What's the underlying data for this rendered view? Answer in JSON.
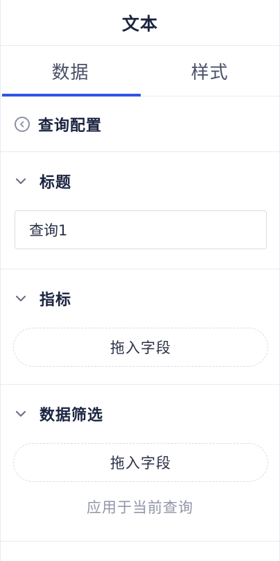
{
  "header": {
    "title": "文本"
  },
  "tabs": [
    {
      "label": "数据",
      "active": true
    },
    {
      "label": "样式",
      "active": false
    }
  ],
  "query_config": {
    "label": "查询配置",
    "icon": "back-circle-icon"
  },
  "sections": {
    "title": {
      "label": "标题",
      "input_value": "查询1",
      "icon": "chevron-down-icon"
    },
    "metric": {
      "label": "指标",
      "drop_label": "拖入字段",
      "icon": "chevron-down-icon"
    },
    "filter": {
      "label": "数据筛选",
      "drop_label": "拖入字段",
      "apply_label": "应用于当前查询",
      "icon": "chevron-down-icon"
    }
  },
  "colors": {
    "accent": "#2f54eb",
    "text_primary": "#1a2440",
    "text_muted": "#9096a8",
    "border": "#e8eaef"
  }
}
